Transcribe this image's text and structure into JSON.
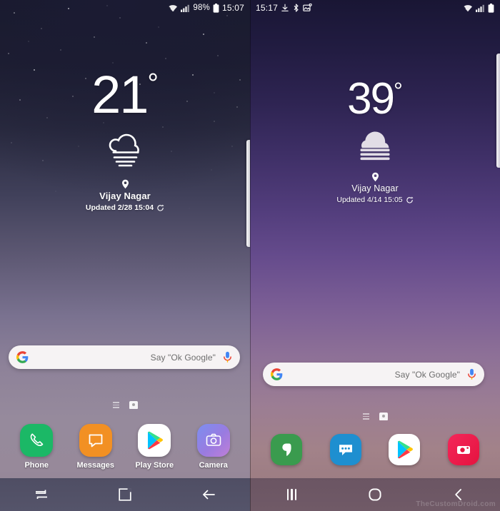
{
  "left_phone": {
    "status_bar": {
      "icons_right": [
        "wifi-icon",
        "signal-icon"
      ],
      "battery_percent": "98%",
      "battery_icon": "battery-icon",
      "time": "15:07"
    },
    "weather_widget": {
      "temperature": "21",
      "degree_symbol": "°",
      "condition_icon": "cloud-fog-outline-icon",
      "location_pin_icon": "location-pin-icon",
      "city": "Vijay Nagar",
      "updated": "Updated 2/28 15:04",
      "refresh_icon": "refresh-icon"
    },
    "search_bar": {
      "logo_icon": "google-g-icon",
      "placeholder": "Say \"Ok Google\"",
      "mic_icon": "microphone-icon"
    },
    "page_indicator": {
      "lines_icon": "page-lines-icon",
      "home_icon": "home-page-icon"
    },
    "dock": [
      {
        "label": "Phone",
        "icon": "phone-icon",
        "color": "#1bb866"
      },
      {
        "label": "Messages",
        "icon": "messages-icon",
        "color": "#f29023"
      },
      {
        "label": "Play Store",
        "icon": "play-store-icon",
        "color": "#ffffff"
      },
      {
        "label": "Camera",
        "icon": "camera-icon",
        "color": "#9a7be0"
      }
    ],
    "nav_bar": [
      {
        "name": "recents-button",
        "icon": "recents-swap-icon"
      },
      {
        "name": "home-button",
        "icon": "home-square-icon"
      },
      {
        "name": "back-button",
        "icon": "back-arrow-icon"
      }
    ],
    "edge_handle_icon": "edge-panel-handle"
  },
  "right_phone": {
    "status_bar": {
      "time": "15:17",
      "notification_icons": [
        "download-icon",
        "bluetooth-icon",
        "screenshot-icon"
      ],
      "icons_right": [
        "wifi-icon",
        "signal-icon",
        "battery-icon"
      ]
    },
    "weather_widget": {
      "temperature": "39",
      "degree_symbol": "°",
      "condition_icon": "cloud-fog-filled-icon",
      "location_pin_icon": "location-pin-icon",
      "city": "Vijay Nagar",
      "updated": "Updated 4/14 15:05",
      "refresh_icon": "refresh-icon"
    },
    "search_bar": {
      "logo_icon": "google-g-icon",
      "placeholder": "Say \"Ok Google\"",
      "mic_icon": "microphone-icon"
    },
    "page_indicator": {
      "lines_icon": "page-lines-icon",
      "home_icon": "home-page-icon"
    },
    "dock": [
      {
        "label": "",
        "icon": "phone-icon",
        "color": "#3a9b4e"
      },
      {
        "label": "",
        "icon": "messages-icon",
        "color": "#1e8fd0"
      },
      {
        "label": "",
        "icon": "play-store-icon",
        "color": "#ffffff"
      },
      {
        "label": "",
        "icon": "camera-icon",
        "color": "#e5133f"
      }
    ],
    "nav_bar": [
      {
        "name": "recents-button",
        "icon": "recents-bars-icon"
      },
      {
        "name": "home-button",
        "icon": "home-circle-icon"
      },
      {
        "name": "back-button",
        "icon": "back-chevron-icon"
      }
    ],
    "edge_handle_icon": "edge-panel-handle",
    "watermark": "TheCustomDroid.com"
  }
}
